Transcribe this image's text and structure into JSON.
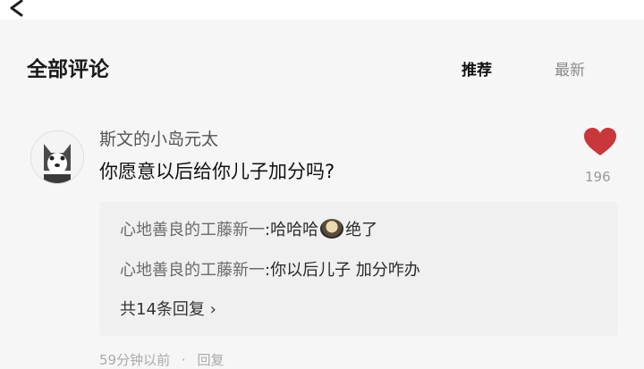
{
  "header": {
    "title": "全部评论",
    "sort_recommended": "推荐",
    "sort_latest": "最新"
  },
  "comment": {
    "username": "斯文的小岛元太",
    "text": "你愿意以后给你儿子加分吗?",
    "like_count": "196",
    "replies": [
      {
        "user": "心地善良的工藤新一",
        "sep": ":",
        "text_before": "哈哈哈",
        "has_emoji": true,
        "text_after": "绝了"
      },
      {
        "user": "心地善良的工藤新一",
        "sep": ":",
        "text_before": "你以后儿子 加分咋办",
        "has_emoji": false,
        "text_after": ""
      }
    ],
    "more_replies": "共14条回复",
    "more_arrow": "›",
    "meta_time": "59分钟以前",
    "meta_reply": "回复"
  },
  "colors": {
    "like_heart": "#c8373b",
    "background": "#f6f6f6"
  },
  "icons": [
    "back-arrow-icon",
    "heart-icon",
    "chevron-right-icon",
    "laughing-emoji-icon"
  ]
}
